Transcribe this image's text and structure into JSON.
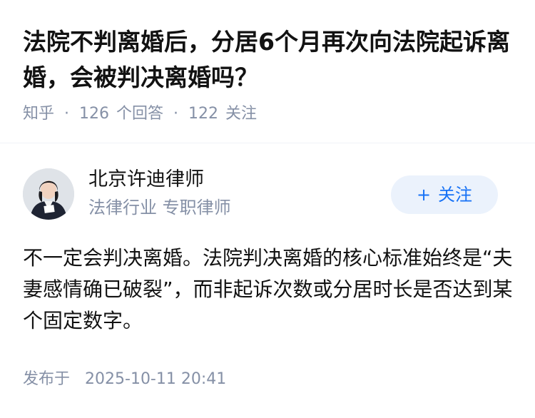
{
  "question": {
    "title": "法院不判离婚后，分居6个月再次向法院起诉离婚，会被判决离婚吗？"
  },
  "meta": {
    "source": "知乎",
    "answers_count": "126",
    "answers_label": "个回答",
    "followers_count": "122",
    "followers_label": "关注"
  },
  "author": {
    "name": "北京许迪律师",
    "headline": "法律行业 专职律师",
    "follow_label": "关注",
    "follow_icon": "plus-icon"
  },
  "answer": {
    "content": "不一定会判决离婚。法院判决离婚的核心标准始终是“夫妻感情确已破裂”，而非起诉次数或分居时长是否达到某个固定数字。",
    "published_label": "发布于",
    "published_time": "2025-10-11 20:41"
  },
  "colors": {
    "accent": "#1772f6",
    "follow_bg": "#ebf2fc",
    "meta_gray": "#8590a6"
  }
}
